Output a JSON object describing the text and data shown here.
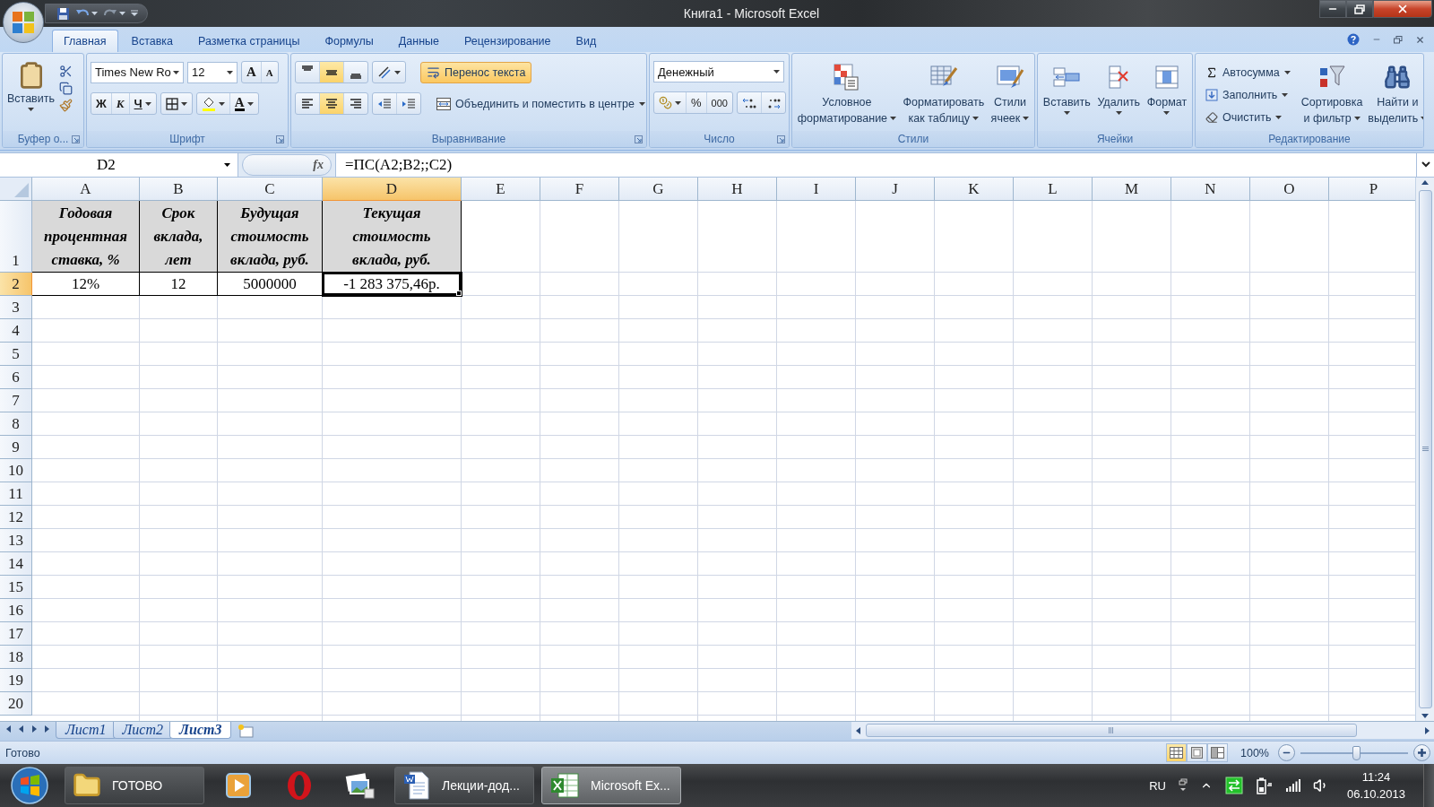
{
  "window": {
    "title": "Книга1 - Microsoft Excel"
  },
  "ribbon_tabs": [
    {
      "label": "Главная",
      "selected": true
    },
    {
      "label": "Вставка",
      "selected": false
    },
    {
      "label": "Разметка страницы",
      "selected": false
    },
    {
      "label": "Формулы",
      "selected": false
    },
    {
      "label": "Данные",
      "selected": false
    },
    {
      "label": "Рецензирование",
      "selected": false
    },
    {
      "label": "Вид",
      "selected": false
    }
  ],
  "clipboard": {
    "title": "Буфер о...",
    "paste": "Вставить"
  },
  "font": {
    "title": "Шрифт",
    "name": "Times New Ro",
    "size": "12",
    "grow": "A",
    "shrink": "A",
    "bold": "Ж",
    "italic": "К",
    "underline": "Ч",
    "color_letter": "A"
  },
  "alignment": {
    "title": "Выравнивание",
    "vertical": [
      {
        "selected": false
      },
      {
        "selected": true
      },
      {
        "selected": false
      }
    ],
    "horizontal": [
      {
        "selected": false
      },
      {
        "selected": true
      },
      {
        "selected": false
      }
    ],
    "wrap_text": {
      "label": "Перенос текста",
      "on": true
    },
    "merge": "Объединить и поместить в центре"
  },
  "number": {
    "title": "Число",
    "format": "Денежный",
    "percent": "%",
    "thousands": "000"
  },
  "styles": {
    "title": "Стили",
    "buttons": [
      {
        "kind": "conditional",
        "lines": [
          "Условное",
          "форматирование"
        ]
      },
      {
        "kind": "table",
        "lines": [
          "Форматировать",
          "как таблицу"
        ]
      },
      {
        "kind": "cell",
        "lines": [
          "Стили",
          "ячеек"
        ]
      }
    ]
  },
  "cells": {
    "title": "Ячейки",
    "buttons": [
      {
        "kind": "insert",
        "label": "Вставить"
      },
      {
        "kind": "delete",
        "label": "Удалить"
      },
      {
        "kind": "format",
        "label": "Формат"
      }
    ]
  },
  "editing": {
    "title": "Редактирование",
    "small": [
      {
        "kind": "sum",
        "label": "Автосумма"
      },
      {
        "kind": "fill",
        "label": "Заполнить"
      },
      {
        "kind": "clear",
        "label": "Очистить"
      }
    ],
    "big": [
      {
        "kind": "sort",
        "lines": [
          "Сортировка",
          "и фильтр"
        ]
      },
      {
        "kind": "find",
        "lines": [
          "Найти и",
          "выделить"
        ]
      }
    ]
  },
  "formula_bar": {
    "name_box": "D2",
    "fx": "fx",
    "formula": "=ПС(A2;B2;;C2)"
  },
  "sheet": {
    "columns": [
      {
        "label": "A",
        "selected": false
      },
      {
        "label": "B",
        "selected": false
      },
      {
        "label": "C",
        "selected": false
      },
      {
        "label": "D",
        "selected": true
      },
      {
        "label": "E",
        "selected": false
      },
      {
        "label": "F",
        "selected": false
      },
      {
        "label": "G",
        "selected": false
      },
      {
        "label": "H",
        "selected": false
      },
      {
        "label": "I",
        "selected": false
      },
      {
        "label": "J",
        "selected": false
      },
      {
        "label": "K",
        "selected": false
      },
      {
        "label": "L",
        "selected": false
      },
      {
        "label": "M",
        "selected": false
      },
      {
        "label": "N",
        "selected": false
      },
      {
        "label": "O",
        "selected": false
      },
      {
        "label": "P",
        "selected": false
      }
    ],
    "rows": [
      {
        "label": "1",
        "selected": false,
        "kind": "header",
        "cells": [
          "Годовая процентная ставка, %",
          "Срок вклада, лет",
          "Будущая стоимость вклада, руб.",
          "Текущая стоимость вклада, руб."
        ]
      },
      {
        "label": "2",
        "selected": true,
        "kind": "value",
        "cells": [
          "12%",
          "12",
          "5000000",
          "-1 283 375,46р."
        ]
      },
      {
        "label": "3",
        "selected": false
      },
      {
        "label": "4",
        "selected": false
      },
      {
        "label": "5",
        "selected": false
      },
      {
        "label": "6",
        "selected": false
      },
      {
        "label": "7",
        "selected": false
      },
      {
        "label": "8",
        "selected": false
      },
      {
        "label": "9",
        "selected": false
      },
      {
        "label": "10",
        "selected": false
      },
      {
        "label": "11",
        "selected": false
      },
      {
        "label": "12",
        "selected": false
      },
      {
        "label": "13",
        "selected": false
      },
      {
        "label": "14",
        "selected": false
      },
      {
        "label": "15",
        "selected": false
      },
      {
        "label": "16",
        "selected": false
      },
      {
        "label": "17",
        "selected": false
      },
      {
        "label": "18",
        "selected": false
      },
      {
        "label": "19",
        "selected": false
      },
      {
        "label": "20",
        "selected": false
      }
    ]
  },
  "sheet_tabs": [
    {
      "label": "Лист1",
      "selected": false
    },
    {
      "label": "Лист2",
      "selected": false
    },
    {
      "label": "Лист3",
      "selected": true
    }
  ],
  "status_bar": {
    "text": "Готово",
    "view_modes": [
      {
        "kind": "normal",
        "selected": true
      },
      {
        "kind": "layout",
        "selected": false
      },
      {
        "kind": "pagebreak",
        "selected": false
      }
    ],
    "zoom": "100%",
    "zoom_slider": {
      "level": 0.52
    }
  },
  "taskbar": {
    "items": [
      {
        "kind": "folder",
        "label": "ГОТОВО",
        "selected": false
      },
      {
        "kind": "media",
        "selected": false
      },
      {
        "kind": "opera",
        "selected": false
      },
      {
        "kind": "photos",
        "selected": false
      },
      {
        "kind": "word",
        "label": "Лекции-дод...",
        "selected": false
      },
      {
        "kind": "excel",
        "label": "Microsoft Ex...",
        "selected": true
      }
    ],
    "tray": {
      "language": "RU",
      "time": "11:24",
      "date": "06.10.2013"
    }
  }
}
